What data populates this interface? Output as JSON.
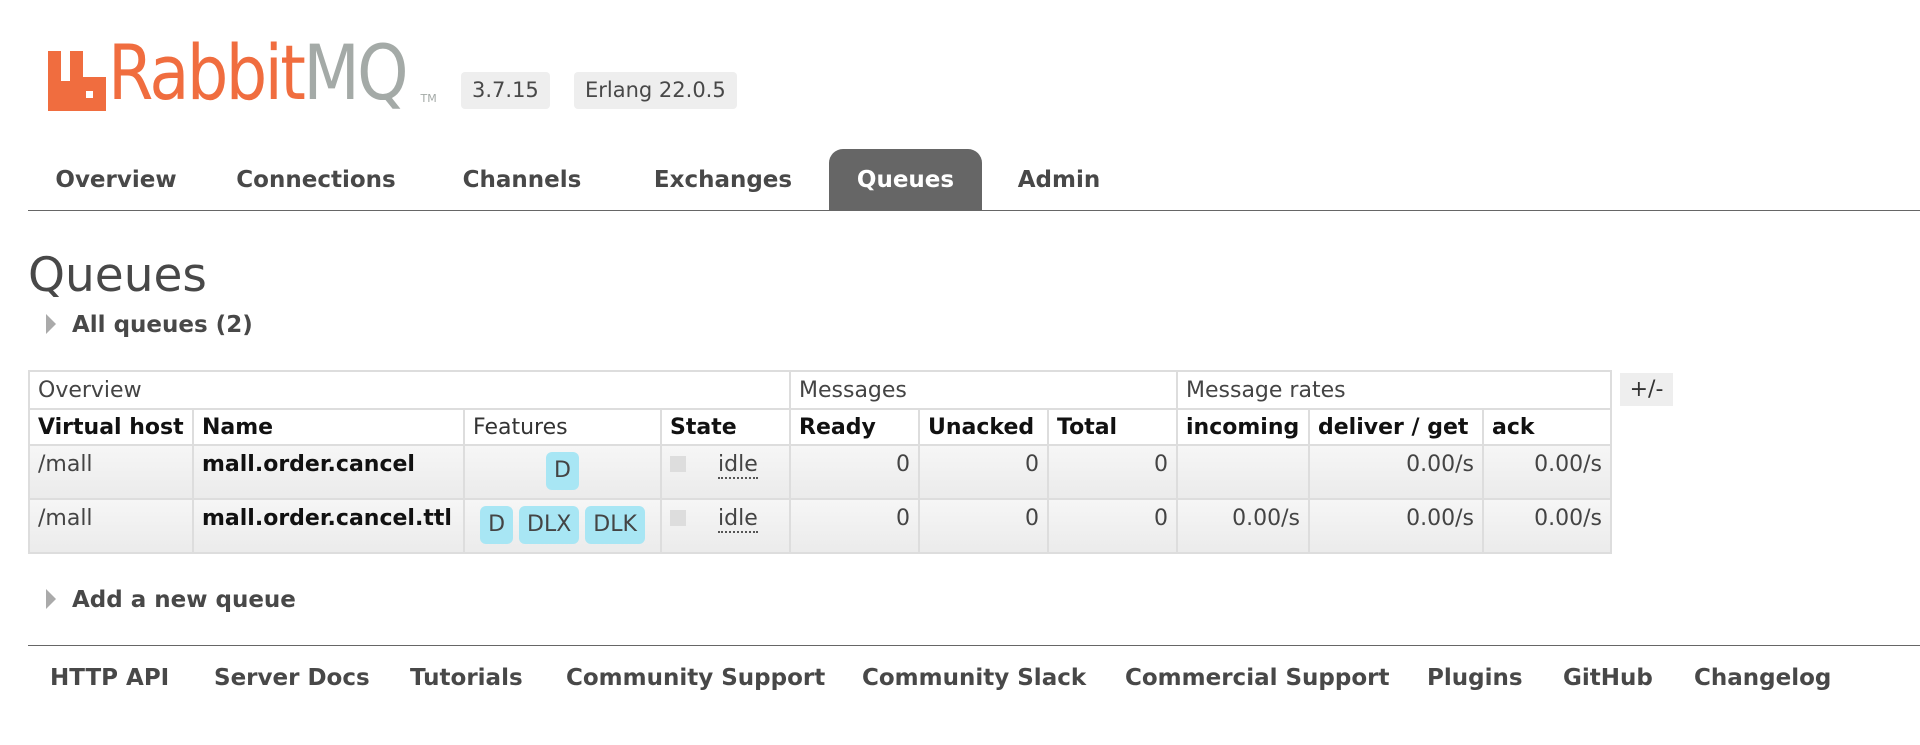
{
  "header": {
    "logo": {
      "word_rabbit": "Rabbit",
      "word_mq": "MQ",
      "trademark": "TM"
    },
    "version": "3.7.15",
    "erlang": "Erlang 22.0.5"
  },
  "tabs": [
    {
      "label": "Overview",
      "selected": false
    },
    {
      "label": "Connections",
      "selected": false
    },
    {
      "label": "Channels",
      "selected": false
    },
    {
      "label": "Exchanges",
      "selected": false
    },
    {
      "label": "Queues",
      "selected": true
    },
    {
      "label": "Admin",
      "selected": false
    }
  ],
  "main": {
    "title": "Queues",
    "all_queues_label": "All queues (2)",
    "add_queue_label": "Add a new queue",
    "plus_minus": "+/-"
  },
  "table": {
    "groups": [
      "Overview",
      "Messages",
      "Message rates"
    ],
    "columns": [
      "Virtual host",
      "Name",
      "Features",
      "State",
      "Ready",
      "Unacked",
      "Total",
      "incoming",
      "deliver / get",
      "ack"
    ],
    "rows": [
      {
        "vhost": "/mall",
        "name": "mall.order.cancel",
        "features": [
          "D"
        ],
        "state": "idle",
        "ready": "0",
        "unacked": "0",
        "total": "0",
        "incoming": "",
        "deliver_get": "0.00/s",
        "ack": "0.00/s"
      },
      {
        "vhost": "/mall",
        "name": "mall.order.cancel.ttl",
        "features": [
          "D",
          "DLX",
          "DLK"
        ],
        "state": "idle",
        "ready": "0",
        "unacked": "0",
        "total": "0",
        "incoming": "0.00/s",
        "deliver_get": "0.00/s",
        "ack": "0.00/s"
      }
    ]
  },
  "footer": {
    "links": [
      "HTTP API",
      "Server Docs",
      "Tutorials",
      "Community Support",
      "Community Slack",
      "Commercial Support",
      "Plugins",
      "GitHub",
      "Changelog"
    ]
  },
  "colors": {
    "brand_orange": "#f06d3f",
    "brand_gray": "#a4aaa7",
    "selected_tab": "#666666",
    "feature_badge": "#a8e6f4"
  }
}
